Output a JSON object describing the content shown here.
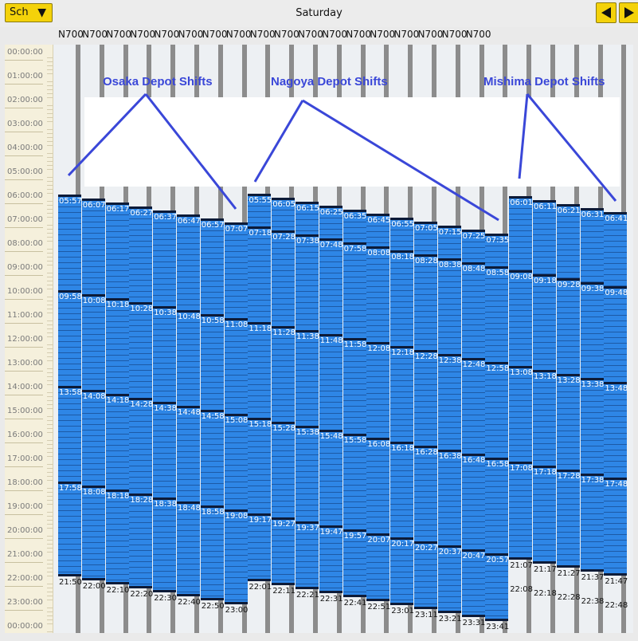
{
  "toolbar": {
    "schedule_label": "Sch",
    "dropdown_icon": "chevron-down-icon",
    "prev_icon": "left-arrow-icon",
    "next_icon": "right-arrow-icon"
  },
  "header": {
    "title": "Saturday"
  },
  "columns": {
    "label": "N700",
    "count": 18
  },
  "time_axis": [
    "00:00:00",
    "01:00:00",
    "02:00:00",
    "03:00:00",
    "04:00:00",
    "05:00:00",
    "06:00:00",
    "07:00:00",
    "08:00:00",
    "09:00:00",
    "10:00:00",
    "11:00:00",
    "12:00:00",
    "13:00:00",
    "14:00:00",
    "15:00:00",
    "16:00:00",
    "17:00:00",
    "18:00:00",
    "19:00:00",
    "20:00:00",
    "21:00:00",
    "22:00:00",
    "23:00:00",
    "00:00:00"
  ],
  "annotations": {
    "osaka": "Osaka Depot Shifts",
    "nagoya": "Nagoya Depot Shifts",
    "mishima": "Mishima Depot Shifts"
  },
  "colors": {
    "shift_dark": "#1d5aa6",
    "shift_light": "#2e86e6",
    "block_edge": "#0d1b38",
    "annotation": "#3a47d8"
  },
  "shifts": [
    {
      "start": "05:57",
      "marks": [
        "09:58",
        "13:58",
        "17:58"
      ],
      "end": "21:50"
    },
    {
      "start": "06:07",
      "marks": [
        "10:08",
        "14:08",
        "18:08"
      ],
      "end": "22:00"
    },
    {
      "start": "06:17",
      "marks": [
        "10:18",
        "14:18",
        "18:18"
      ],
      "end": "22:10"
    },
    {
      "start": "06:27",
      "marks": [
        "10:28",
        "14:28",
        "18:28"
      ],
      "end": "22:20"
    },
    {
      "start": "06:37",
      "marks": [
        "10:38",
        "14:38",
        "18:38"
      ],
      "end": "22:30"
    },
    {
      "start": "06:47",
      "marks": [
        "10:48",
        "14:48",
        "18:48"
      ],
      "end": "22:40"
    },
    {
      "start": "06:57",
      "marks": [
        "10:58",
        "14:58",
        "18:58"
      ],
      "end": "22:50"
    },
    {
      "start": "07:07",
      "marks": [
        "11:08",
        "15:08",
        "19:08"
      ],
      "end": "23:00"
    },
    {
      "start": "05:55",
      "marks": [
        "07:18",
        "11:18",
        "15:18",
        "19:17"
      ],
      "end": "22:01"
    },
    {
      "start": "06:05",
      "marks": [
        "07:28",
        "11:28",
        "15:28",
        "19:27"
      ],
      "end": "22:11"
    },
    {
      "start": "06:15",
      "marks": [
        "07:38",
        "11:38",
        "15:38",
        "19:37"
      ],
      "end": "22:21"
    },
    {
      "start": "06:25",
      "marks": [
        "07:48",
        "11:48",
        "15:48",
        "19:47"
      ],
      "end": "22:31"
    },
    {
      "start": "06:35",
      "marks": [
        "07:58",
        "11:58",
        "15:58",
        "19:57"
      ],
      "end": "22:41"
    },
    {
      "start": "06:45",
      "marks": [
        "08:08",
        "12:08",
        "16:08",
        "20:07"
      ],
      "end": "22:51"
    },
    {
      "start": "06:55",
      "marks": [
        "08:18",
        "12:18",
        "16:18",
        "20:17"
      ],
      "end": "23:01"
    },
    {
      "start": "07:05",
      "marks": [
        "08:28",
        "12:28",
        "16:28",
        "20:27"
      ],
      "end": "23:11"
    },
    {
      "start": "07:15",
      "marks": [
        "08:38",
        "12:38",
        "16:38",
        "20:37"
      ],
      "end": "23:21"
    },
    {
      "start": "07:25",
      "marks": [
        "08:48",
        "12:48",
        "16:48",
        "20:47"
      ],
      "end": "23:31"
    },
    {
      "start": "07:35",
      "marks": [
        "08:58",
        "12:58",
        "16:58",
        "20:57"
      ],
      "end": "23:41"
    },
    {
      "start": "06:01",
      "marks": [
        "09:08",
        "13:08",
        "17:08"
      ],
      "end": "21:07"
    },
    {
      "start": "06:11",
      "marks": [
        "09:18",
        "13:18",
        "17:18"
      ],
      "end": "21:17"
    },
    {
      "start": "06:21",
      "marks": [
        "09:28",
        "13:28",
        "17:28"
      ],
      "end": "21:27"
    },
    {
      "start": "06:31",
      "marks": [
        "09:38",
        "13:38",
        "17:38"
      ],
      "end": "21:37"
    },
    {
      "start": "06:41",
      "marks": [
        "09:48",
        "13:48",
        "17:48"
      ],
      "end": "21:47"
    }
  ],
  "extra_end_labels": [
    "22:08",
    "22:18",
    "22:28",
    "22:38",
    "22:48"
  ]
}
